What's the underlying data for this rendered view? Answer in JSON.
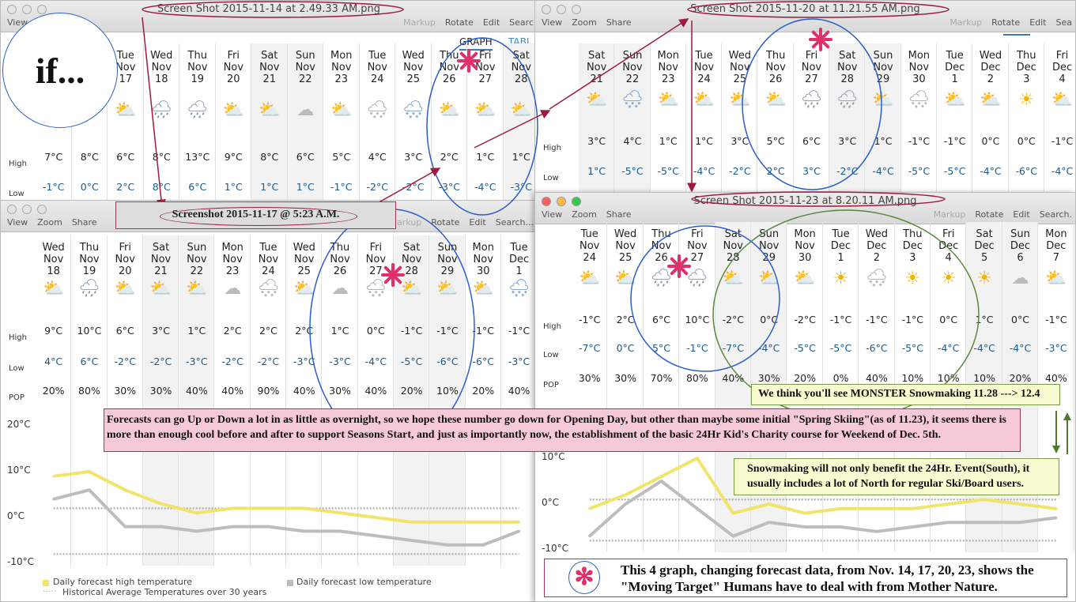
{
  "colors": {
    "accent_red": "#9b1c3c",
    "circle_blue": "#2a5fc7",
    "circle_green": "#5a8a3a",
    "asterisk": "#e0306a",
    "high_line": "#f0e46a",
    "low_line": "#bdbdbd",
    "pink_note": "#f6c9d8",
    "yellow_note": "#f8fbd0"
  },
  "if_label": "if...",
  "windows": [
    {
      "id": "a",
      "title": "Screen Shot 2015-11-14 at 2.49.33 AM.png",
      "toolbar_left": [
        "View"
      ],
      "toolbar_right": [
        "Markup",
        "Rotate",
        "Edit",
        "Searc"
      ],
      "tabs": [
        "GRAPH",
        "TABL"
      ],
      "row_labels": {
        "high": "High",
        "low": "Low"
      },
      "days": [
        {
          "dow": "",
          "mon": "",
          "day": "",
          "icon": "sun-cloud",
          "high": "7°C",
          "low": "-1°C"
        },
        {
          "dow": "",
          "mon": "",
          "day": "",
          "icon": "sun",
          "high": "8°C",
          "low": "0°C"
        },
        {
          "dow": "Tue",
          "mon": "Nov",
          "day": "17",
          "icon": "sun-cloud",
          "high": "6°C",
          "low": "2°C"
        },
        {
          "dow": "Wed",
          "mon": "Nov",
          "day": "18",
          "icon": "rain",
          "high": "8°C",
          "low": "8°C"
        },
        {
          "dow": "Thu",
          "mon": "Nov",
          "day": "19",
          "icon": "rain",
          "high": "13°C",
          "low": "6°C"
        },
        {
          "dow": "Fri",
          "mon": "Nov",
          "day": "20",
          "icon": "sun-cloud",
          "high": "9°C",
          "low": "1°C"
        },
        {
          "dow": "Sat",
          "mon": "Nov",
          "day": "21",
          "icon": "sun-cloud",
          "high": "8°C",
          "low": "1°C"
        },
        {
          "dow": "Sun",
          "mon": "Nov",
          "day": "22",
          "icon": "cloud",
          "high": "6°C",
          "low": "1°C"
        },
        {
          "dow": "Mon",
          "mon": "Nov",
          "day": "23",
          "icon": "sun-cloud",
          "high": "5°C",
          "low": "-1°C"
        },
        {
          "dow": "Tue",
          "mon": "Nov",
          "day": "24",
          "icon": "snow",
          "high": "4°C",
          "low": "-2°C"
        },
        {
          "dow": "Wed",
          "mon": "Nov",
          "day": "25",
          "icon": "rain-snow",
          "high": "3°C",
          "low": "-2°C"
        },
        {
          "dow": "Thu",
          "mon": "Nov",
          "day": "26",
          "icon": "sun-cloud-snow",
          "high": "2°C",
          "low": "-3°C"
        },
        {
          "dow": "Fri",
          "mon": "Nov",
          "day": "27",
          "icon": "sun-cloud",
          "high": "1°C",
          "low": "-4°C"
        },
        {
          "dow": "Sat",
          "mon": "Nov",
          "day": "28",
          "icon": "sun-cloud-snow",
          "high": "1°C",
          "low": "-3°C"
        }
      ]
    },
    {
      "id": "b",
      "title": "Screen Shot 2015-11-20 at 11.21.55 AM.png",
      "toolbar_left": [
        "View",
        "Zoom",
        "Share"
      ],
      "toolbar_right": [
        "Markup",
        "Rotate",
        "Edit",
        "Sea"
      ],
      "row_labels": {
        "high": "High",
        "low": "Low"
      },
      "days": [
        {
          "dow": "Sat",
          "mon": "Nov",
          "day": "21",
          "icon": "sun-cloud",
          "high": "3°C",
          "low": "1°C"
        },
        {
          "dow": "Sun",
          "mon": "Nov",
          "day": "22",
          "icon": "rain-snow",
          "high": "4°C",
          "low": "-5°C"
        },
        {
          "dow": "Mon",
          "mon": "Nov",
          "day": "23",
          "icon": "sun-cloud",
          "high": "1°C",
          "low": "-5°C"
        },
        {
          "dow": "Tue",
          "mon": "Nov",
          "day": "24",
          "icon": "sun-cloud",
          "high": "1°C",
          "low": "-4°C"
        },
        {
          "dow": "Wed",
          "mon": "Nov",
          "day": "25",
          "icon": "sun-cloud",
          "high": "3°C",
          "low": "-2°C"
        },
        {
          "dow": "Thu",
          "mon": "Nov",
          "day": "26",
          "icon": "sun-cloud",
          "high": "5°C",
          "low": "2°C"
        },
        {
          "dow": "Fri",
          "mon": "Nov",
          "day": "27",
          "icon": "rain",
          "high": "6°C",
          "low": "3°C"
        },
        {
          "dow": "Sat",
          "mon": "Nov",
          "day": "28",
          "icon": "rain",
          "high": "3°C",
          "low": "-2°C"
        },
        {
          "dow": "Sun",
          "mon": "Nov",
          "day": "29",
          "icon": "sun-cloud",
          "high": "1°C",
          "low": "-4°C"
        },
        {
          "dow": "Mon",
          "mon": "Nov",
          "day": "30",
          "icon": "snow",
          "high": "-1°C",
          "low": "-5°C"
        },
        {
          "dow": "Tue",
          "mon": "Dec",
          "day": "1",
          "icon": "sun-cloud-snow",
          "high": "-1°C",
          "low": "-5°C"
        },
        {
          "dow": "Wed",
          "mon": "Dec",
          "day": "2",
          "icon": "sun-cloud",
          "high": "0°C",
          "low": "-4°C"
        },
        {
          "dow": "Thu",
          "mon": "Dec",
          "day": "3",
          "icon": "sun",
          "high": "0°C",
          "low": "-6°C"
        },
        {
          "dow": "Fri",
          "mon": "Dec",
          "day": "4",
          "icon": "sun-cloud",
          "high": "-1°C",
          "low": "-4°C"
        }
      ]
    },
    {
      "id": "c",
      "title": "Screenshot 2015-11-17 @ 5:23 A.M.",
      "toolbar_left": [
        "View",
        "Zoom",
        "Share"
      ],
      "toolbar_right": [
        "Markup",
        "Rotate",
        "Edit",
        "Search..."
      ],
      "row_labels": {
        "high": "High",
        "low": "Low",
        "pop": "POP"
      },
      "days": [
        {
          "dow": "Wed",
          "mon": "Nov",
          "day": "18",
          "icon": "sun-cloud",
          "high": "9°C",
          "low": "4°C",
          "pop": "20%"
        },
        {
          "dow": "Thu",
          "mon": "Nov",
          "day": "19",
          "icon": "rain",
          "high": "10°C",
          "low": "6°C",
          "pop": "80%"
        },
        {
          "dow": "Fri",
          "mon": "Nov",
          "day": "20",
          "icon": "sun-cloud",
          "high": "6°C",
          "low": "-2°C",
          "pop": "30%"
        },
        {
          "dow": "Sat",
          "mon": "Nov",
          "day": "21",
          "icon": "sun-cloud",
          "high": "3°C",
          "low": "-2°C",
          "pop": "30%"
        },
        {
          "dow": "Sun",
          "mon": "Nov",
          "day": "22",
          "icon": "sun-cloud",
          "high": "1°C",
          "low": "-3°C",
          "pop": "40%"
        },
        {
          "dow": "Mon",
          "mon": "Nov",
          "day": "23",
          "icon": "cloud",
          "high": "2°C",
          "low": "-2°C",
          "pop": "40%"
        },
        {
          "dow": "Tue",
          "mon": "Nov",
          "day": "24",
          "icon": "snow",
          "high": "2°C",
          "low": "-2°C",
          "pop": "90%"
        },
        {
          "dow": "Wed",
          "mon": "Nov",
          "day": "25",
          "icon": "sun-cloud",
          "high": "2°C",
          "low": "-3°C",
          "pop": "40%"
        },
        {
          "dow": "Thu",
          "mon": "Nov",
          "day": "26",
          "icon": "cloud",
          "high": "1°C",
          "low": "-3°C",
          "pop": "30%"
        },
        {
          "dow": "Fri",
          "mon": "Nov",
          "day": "27",
          "icon": "snow",
          "high": "0°C",
          "low": "-4°C",
          "pop": "40%"
        },
        {
          "dow": "Sat",
          "mon": "Nov",
          "day": "28",
          "icon": "sun-cloud",
          "high": "-1°C",
          "low": "-5°C",
          "pop": "20%"
        },
        {
          "dow": "Sun",
          "mon": "Nov",
          "day": "29",
          "icon": "sun-cloud",
          "high": "-1°C",
          "low": "-6°C",
          "pop": "10%"
        },
        {
          "dow": "Mon",
          "mon": "Nov",
          "day": "30",
          "icon": "sun-cloud",
          "high": "-1°C",
          "low": "-6°C",
          "pop": "20%"
        },
        {
          "dow": "Tue",
          "mon": "Dec",
          "day": "1",
          "icon": "rain-snow",
          "high": "-1°C",
          "low": "-3°C",
          "pop": "40%"
        }
      ],
      "legend": {
        "high": "Daily forecast high temperature",
        "low": "Daily forecast low temperature",
        "avg": "Historical Average Temperatures over 30 years"
      }
    },
    {
      "id": "d",
      "title": "Screen Shot 2015-11-23 at 8.20.11 AM.png",
      "toolbar_left": [
        "View",
        "Zoom",
        "Share"
      ],
      "toolbar_right": [
        "Markup",
        "Rotate",
        "Edit",
        "Search."
      ],
      "row_labels": {
        "high": "High",
        "low": "Low",
        "pop": "POP"
      },
      "days": [
        {
          "dow": "Tue",
          "mon": "Nov",
          "day": "24",
          "icon": "sun-cloud",
          "high": "-1°C",
          "low": "-7°C",
          "pop": "30%"
        },
        {
          "dow": "Wed",
          "mon": "Nov",
          "day": "25",
          "icon": "sun-cloud",
          "high": "2°C",
          "low": "0°C",
          "pop": "30%"
        },
        {
          "dow": "Thu",
          "mon": "Nov",
          "day": "26",
          "icon": "rain",
          "high": "6°C",
          "low": "5°C",
          "pop": "70%"
        },
        {
          "dow": "Fri",
          "mon": "Nov",
          "day": "27",
          "icon": "rain",
          "high": "10°C",
          "low": "-1°C",
          "pop": "80%"
        },
        {
          "dow": "Sat",
          "mon": "Nov",
          "day": "28",
          "icon": "sun-cloud-snow",
          "high": "-2°C",
          "low": "-7°C",
          "pop": "40%"
        },
        {
          "dow": "Sun",
          "mon": "Nov",
          "day": "29",
          "icon": "sun-cloud",
          "high": "0°C",
          "low": "-4°C",
          "pop": "30%"
        },
        {
          "dow": "Mon",
          "mon": "Nov",
          "day": "30",
          "icon": "sun-cloud",
          "high": "-2°C",
          "low": "-5°C",
          "pop": "20%"
        },
        {
          "dow": "Tue",
          "mon": "Dec",
          "day": "1",
          "icon": "sun",
          "high": "-1°C",
          "low": "-5°C",
          "pop": "0%"
        },
        {
          "dow": "Wed",
          "mon": "Dec",
          "day": "2",
          "icon": "snow",
          "high": "-1°C",
          "low": "-6°C",
          "pop": "40%"
        },
        {
          "dow": "Thu",
          "mon": "Dec",
          "day": "3",
          "icon": "sun",
          "high": "-1°C",
          "low": "-5°C",
          "pop": "10%"
        },
        {
          "dow": "Fri",
          "mon": "Dec",
          "day": "4",
          "icon": "sun",
          "high": "0°C",
          "low": "-4°C",
          "pop": "10%"
        },
        {
          "dow": "Sat",
          "mon": "Dec",
          "day": "5",
          "icon": "sun",
          "high": "1°C",
          "low": "-4°C",
          "pop": "10%"
        },
        {
          "dow": "Sun",
          "mon": "Dec",
          "day": "6",
          "icon": "cloud",
          "high": "0°C",
          "low": "-4°C",
          "pop": "20%"
        },
        {
          "dow": "Mon",
          "mon": "Dec",
          "day": "7",
          "icon": "sun-cloud-snow",
          "high": "-1°C",
          "low": "-3°C",
          "pop": "40%"
        }
      ]
    }
  ],
  "chart_data": [
    {
      "type": "line",
      "window": "c",
      "ylim": [
        -10,
        20
      ],
      "ytick_labels": [
        "20°C",
        "10°C",
        "0°C",
        "-10°C"
      ],
      "grid": true,
      "legend": "bottom",
      "categories": [
        "Nov 18",
        "Nov 19",
        "Nov 20",
        "Nov 21",
        "Nov 22",
        "Nov 23",
        "Nov 24",
        "Nov 25",
        "Nov 26",
        "Nov 27",
        "Nov 28",
        "Nov 29",
        "Nov 30",
        "Dec 1"
      ],
      "series": [
        {
          "name": "Daily forecast high temperature",
          "values": [
            9,
            10,
            6,
            3,
            1,
            2,
            2,
            2,
            1,
            0,
            -1,
            -1,
            -1,
            -1
          ]
        },
        {
          "name": "Daily forecast low temperature",
          "values": [
            4,
            6,
            -2,
            -2,
            -3,
            -2,
            -2,
            -3,
            -3,
            -4,
            -5,
            -6,
            -6,
            -3
          ]
        }
      ],
      "historical_average": [
        2,
        -8
      ]
    },
    {
      "type": "line",
      "window": "d",
      "ylim": [
        -10,
        20
      ],
      "ytick_labels": [
        "10°C",
        "0°C",
        "-10°C"
      ],
      "grid": true,
      "categories": [
        "Nov 24",
        "Nov 25",
        "Nov 26",
        "Nov 27",
        "Nov 28",
        "Nov 29",
        "Nov 30",
        "Dec 1",
        "Dec 2",
        "Dec 3",
        "Dec 4",
        "Dec 5",
        "Dec 6",
        "Dec 7"
      ],
      "series": [
        {
          "values": [
            -1,
            2,
            6,
            10,
            -2,
            0,
            -2,
            -1,
            -1,
            -1,
            0,
            1,
            0,
            -1
          ]
        },
        {
          "values": [
            -7,
            0,
            5,
            -1,
            -7,
            -4,
            -5,
            -5,
            -6,
            -5,
            -4,
            -4,
            -4,
            -3
          ]
        }
      ],
      "historical_average": [
        1,
        -8
      ]
    }
  ],
  "notes": {
    "pink": "Forecasts can go Up or Down a lot in as little as overnight, so we hope these number go down for Opening Day, but other than maybe some initial \"Spring Skiing\"(as of 11.23), it seems there is more than enough cool before and after to support Seasons Start, and just as importantly now, the establishment of the basic 24Hr Kid's Charity course for Weekend of Dec. 5th.",
    "monster": "We think you'll see MONSTER Snowmaking 11.28 ---> 12.4",
    "snowmaking": "Snowmaking will not only benefit the 24Hr. Event(South), it usually includes a lot of North for regular Ski/Board users.",
    "summary": "This 4 graph, changing forecast data, from Nov. 14, 17, 20, 23, shows the \"Moving Target\" Humans have to deal with from Mother Nature."
  }
}
